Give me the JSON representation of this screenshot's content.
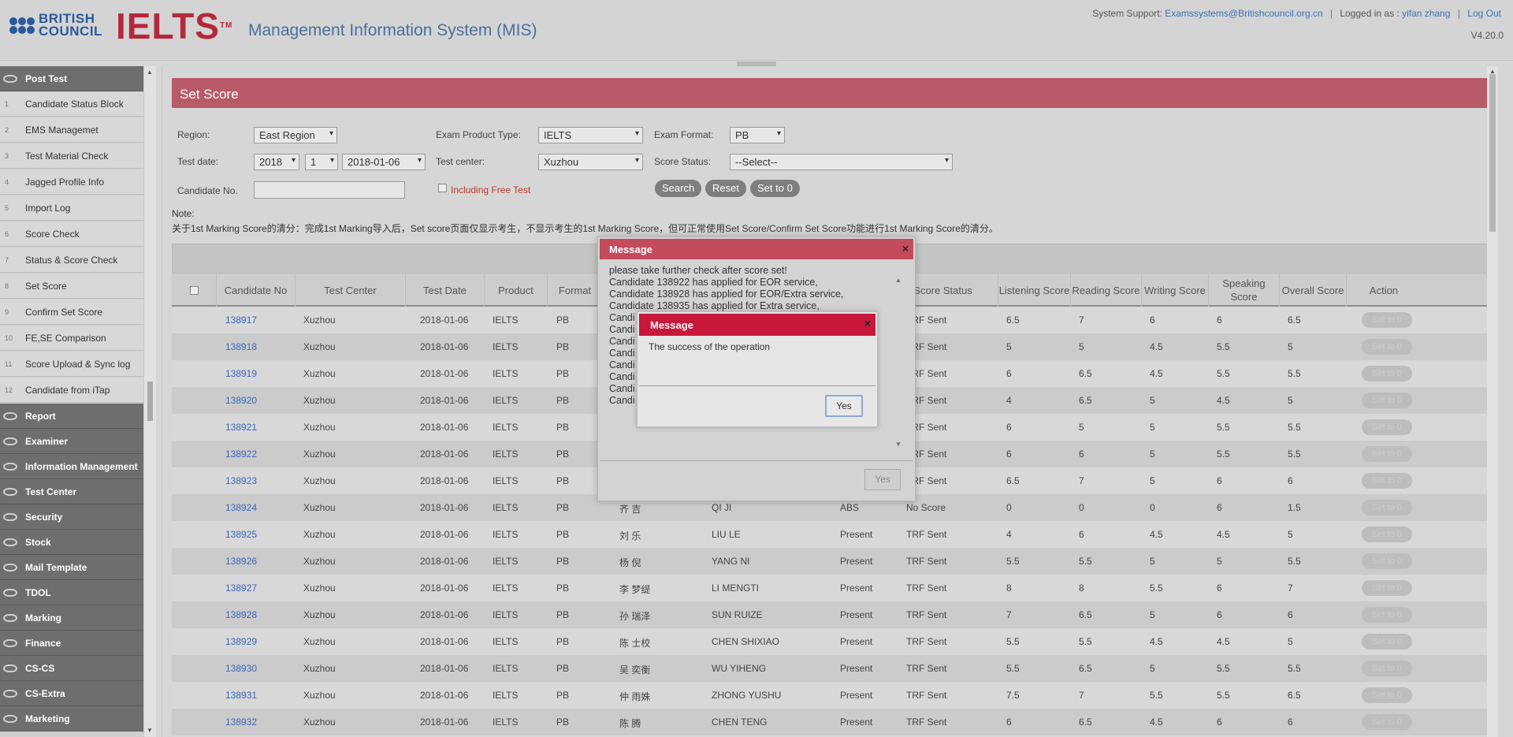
{
  "header": {
    "bc_line1": "BRITISH",
    "bc_line2": "COUNCIL",
    "ielts": "IELTS",
    "tm": "TM",
    "title": "Management Information System (MIS)",
    "support_label": "System Support:",
    "support_email": "Examssystems@Britishcouncil.org.cn",
    "logged_label": "Logged in as :",
    "user": "yifan zhang",
    "logout": "Log Out",
    "version": "V4.20.0"
  },
  "sidebar": {
    "post_test": "Post Test",
    "sub_items": [
      {
        "num": "1",
        "label": "Candidate Status Block"
      },
      {
        "num": "2",
        "label": "EMS Managemet"
      },
      {
        "num": "3",
        "label": "Test Material Check"
      },
      {
        "num": "4",
        "label": "Jagged Profile Info"
      },
      {
        "num": "5",
        "label": "Import Log"
      },
      {
        "num": "6",
        "label": "Score Check"
      },
      {
        "num": "7",
        "label": "Status & Score Check"
      },
      {
        "num": "8",
        "label": "Set Score"
      },
      {
        "num": "9",
        "label": "Confirm Set Score"
      },
      {
        "num": "10",
        "label": "FE,SE Comparison"
      },
      {
        "num": "11",
        "label": "Score Upload & Sync log"
      },
      {
        "num": "12",
        "label": "Candidate from iTap"
      }
    ],
    "main_items": [
      "Report",
      "Examiner",
      "Information Management",
      "Test Center",
      "Security",
      "Stock",
      "Mail Template",
      "TDOL",
      "Marking",
      "Finance",
      "CS-CS",
      "CS-Extra",
      "Marketing"
    ]
  },
  "page": {
    "title": "Set Score",
    "filters": {
      "region_label": "Region:",
      "region": "East Region",
      "product_label": "Exam Product Type:",
      "product": "IELTS",
      "format_label": "Exam Format:",
      "format": "PB",
      "test_date_label": "Test date:",
      "year": "2018",
      "month": "1",
      "date": "2018-01-06",
      "center_label": "Test center:",
      "center": "Xuzhou",
      "status_label": "Score Status:",
      "status": "--Select--",
      "candidate_label": "Candidate No.",
      "free_test_label": "Including Free Test"
    },
    "buttons": {
      "search": "Search",
      "reset": "Reset",
      "set_to_0": "Set to 0"
    },
    "note_label": "Note:",
    "note_text": "关于1st Marking Score的清分：完成1st Marking导入后，Set score页面仅显示考生，不显示考生的1st Marking Score，但可正常使用Set Score/Confirm Set Score功能进行1st Marking Score的清分。"
  },
  "table": {
    "headers": {
      "candidate_no": "Candidate No",
      "test_center": "Test Center",
      "test_date": "Test Date",
      "product": "Product",
      "format": "Format",
      "score_status": "Score Status",
      "listening": "Listening Score",
      "reading": "Reading Score",
      "writing": "Writing Score",
      "speaking": "Speaking Score",
      "overall": "Overall Score",
      "action": "Action"
    },
    "action_label": "Set to 0",
    "rows": [
      {
        "no": "138917",
        "center": "Xuzhou",
        "date": "2018-01-06",
        "product": "IELTS",
        "format": "PB",
        "cname": "",
        "pname": "",
        "att": "",
        "status": "TRF Sent",
        "l": "6.5",
        "r": "7",
        "w": "6",
        "s": "6",
        "o": "6.5"
      },
      {
        "no": "138918",
        "center": "Xuzhou",
        "date": "2018-01-06",
        "product": "IELTS",
        "format": "PB",
        "cname": "",
        "pname": "",
        "att": "",
        "status": "TRF Sent",
        "l": "5",
        "r": "5",
        "w": "4.5",
        "s": "5.5",
        "o": "5"
      },
      {
        "no": "138919",
        "center": "Xuzhou",
        "date": "2018-01-06",
        "product": "IELTS",
        "format": "PB",
        "cname": "",
        "pname": "",
        "att": "",
        "status": "TRF Sent",
        "l": "6",
        "r": "6.5",
        "w": "4.5",
        "s": "5.5",
        "o": "5.5"
      },
      {
        "no": "138920",
        "center": "Xuzhou",
        "date": "2018-01-06",
        "product": "IELTS",
        "format": "PB",
        "cname": "",
        "pname": "",
        "att": "",
        "status": "TRF Sent",
        "l": "4",
        "r": "6.5",
        "w": "5",
        "s": "4.5",
        "o": "5"
      },
      {
        "no": "138921",
        "center": "Xuzhou",
        "date": "2018-01-06",
        "product": "IELTS",
        "format": "PB",
        "cname": "",
        "pname": "",
        "att": "",
        "status": "TRF Sent",
        "l": "6",
        "r": "5",
        "w": "5",
        "s": "5.5",
        "o": "5.5"
      },
      {
        "no": "138922",
        "center": "Xuzhou",
        "date": "2018-01-06",
        "product": "IELTS",
        "format": "PB",
        "cname": "",
        "pname": "",
        "att": "",
        "status": "TRF Sent",
        "l": "6",
        "r": "6",
        "w": "5",
        "s": "5.5",
        "o": "5.5"
      },
      {
        "no": "138923",
        "center": "Xuzhou",
        "date": "2018-01-06",
        "product": "IELTS",
        "format": "PB",
        "cname": "",
        "pname": "",
        "att": "",
        "status": "TRF Sent",
        "l": "6.5",
        "r": "7",
        "w": "5",
        "s": "6",
        "o": "6"
      },
      {
        "no": "138924",
        "center": "Xuzhou",
        "date": "2018-01-06",
        "product": "IELTS",
        "format": "PB",
        "cname": "齐 吉",
        "pname": "QI JI",
        "att": "ABS",
        "status": "No Score",
        "l": "0",
        "r": "0",
        "w": "0",
        "s": "6",
        "o": "1.5"
      },
      {
        "no": "138925",
        "center": "Xuzhou",
        "date": "2018-01-06",
        "product": "IELTS",
        "format": "PB",
        "cname": "刘 乐",
        "pname": "LIU LE",
        "att": "Present",
        "status": "TRF Sent",
        "l": "4",
        "r": "6",
        "w": "4.5",
        "s": "4.5",
        "o": "5"
      },
      {
        "no": "138926",
        "center": "Xuzhou",
        "date": "2018-01-06",
        "product": "IELTS",
        "format": "PB",
        "cname": "杨 倪",
        "pname": "YANG NI",
        "att": "Present",
        "status": "TRF Sent",
        "l": "5.5",
        "r": "5.5",
        "w": "5",
        "s": "5",
        "o": "5.5"
      },
      {
        "no": "138927",
        "center": "Xuzhou",
        "date": "2018-01-06",
        "product": "IELTS",
        "format": "PB",
        "cname": "李 梦缇",
        "pname": "LI MENGTI",
        "att": "Present",
        "status": "TRF Sent",
        "l": "8",
        "r": "8",
        "w": "5.5",
        "s": "6",
        "o": "7"
      },
      {
        "no": "138928",
        "center": "Xuzhou",
        "date": "2018-01-06",
        "product": "IELTS",
        "format": "PB",
        "cname": "孙 瑞泽",
        "pname": "SUN RUIZE",
        "att": "Present",
        "status": "TRF Sent",
        "l": "7",
        "r": "6.5",
        "w": "5",
        "s": "6",
        "o": "6"
      },
      {
        "no": "138929",
        "center": "Xuzhou",
        "date": "2018-01-06",
        "product": "IELTS",
        "format": "PB",
        "cname": "陈 士校",
        "pname": "CHEN SHIXIAO",
        "att": "Present",
        "status": "TRF Sent",
        "l": "5.5",
        "r": "5.5",
        "w": "4.5",
        "s": "4.5",
        "o": "5"
      },
      {
        "no": "138930",
        "center": "Xuzhou",
        "date": "2018-01-06",
        "product": "IELTS",
        "format": "PB",
        "cname": "吴 奕衡",
        "pname": "WU YIHENG",
        "att": "Present",
        "status": "TRF Sent",
        "l": "5.5",
        "r": "6.5",
        "w": "5",
        "s": "5.5",
        "o": "5.5"
      },
      {
        "no": "138931",
        "center": "Xuzhou",
        "date": "2018-01-06",
        "product": "IELTS",
        "format": "PB",
        "cname": "仲 雨姝",
        "pname": "ZHONG YUSHU",
        "att": "Present",
        "status": "TRF Sent",
        "l": "7.5",
        "r": "7",
        "w": "5.5",
        "s": "5.5",
        "o": "6.5"
      },
      {
        "no": "138932",
        "center": "Xuzhou",
        "date": "2018-01-06",
        "product": "IELTS",
        "format": "PB",
        "cname": "陈 腾",
        "pname": "CHEN TENG",
        "att": "Present",
        "status": "TRF Sent",
        "l": "6",
        "r": "6.5",
        "w": "4.5",
        "s": "6",
        "o": "6"
      }
    ]
  },
  "dialog_outer": {
    "title": "Message",
    "close": "×",
    "lines": [
      "please take further check after score set!",
      "Candidate 138922 has applied for EOR service,",
      "Candidate 138928 has applied for EOR/Extra service,",
      "Candidate 138935 has applied for Extra service,",
      "Candi",
      "Candi",
      "Candi",
      "Candi",
      "Candi",
      "Candi",
      "Candi",
      "Candi"
    ],
    "yes": "Yes"
  },
  "dialog_inner": {
    "title": "Message",
    "close": "×",
    "text": "The success of the operation",
    "yes": "Yes"
  }
}
